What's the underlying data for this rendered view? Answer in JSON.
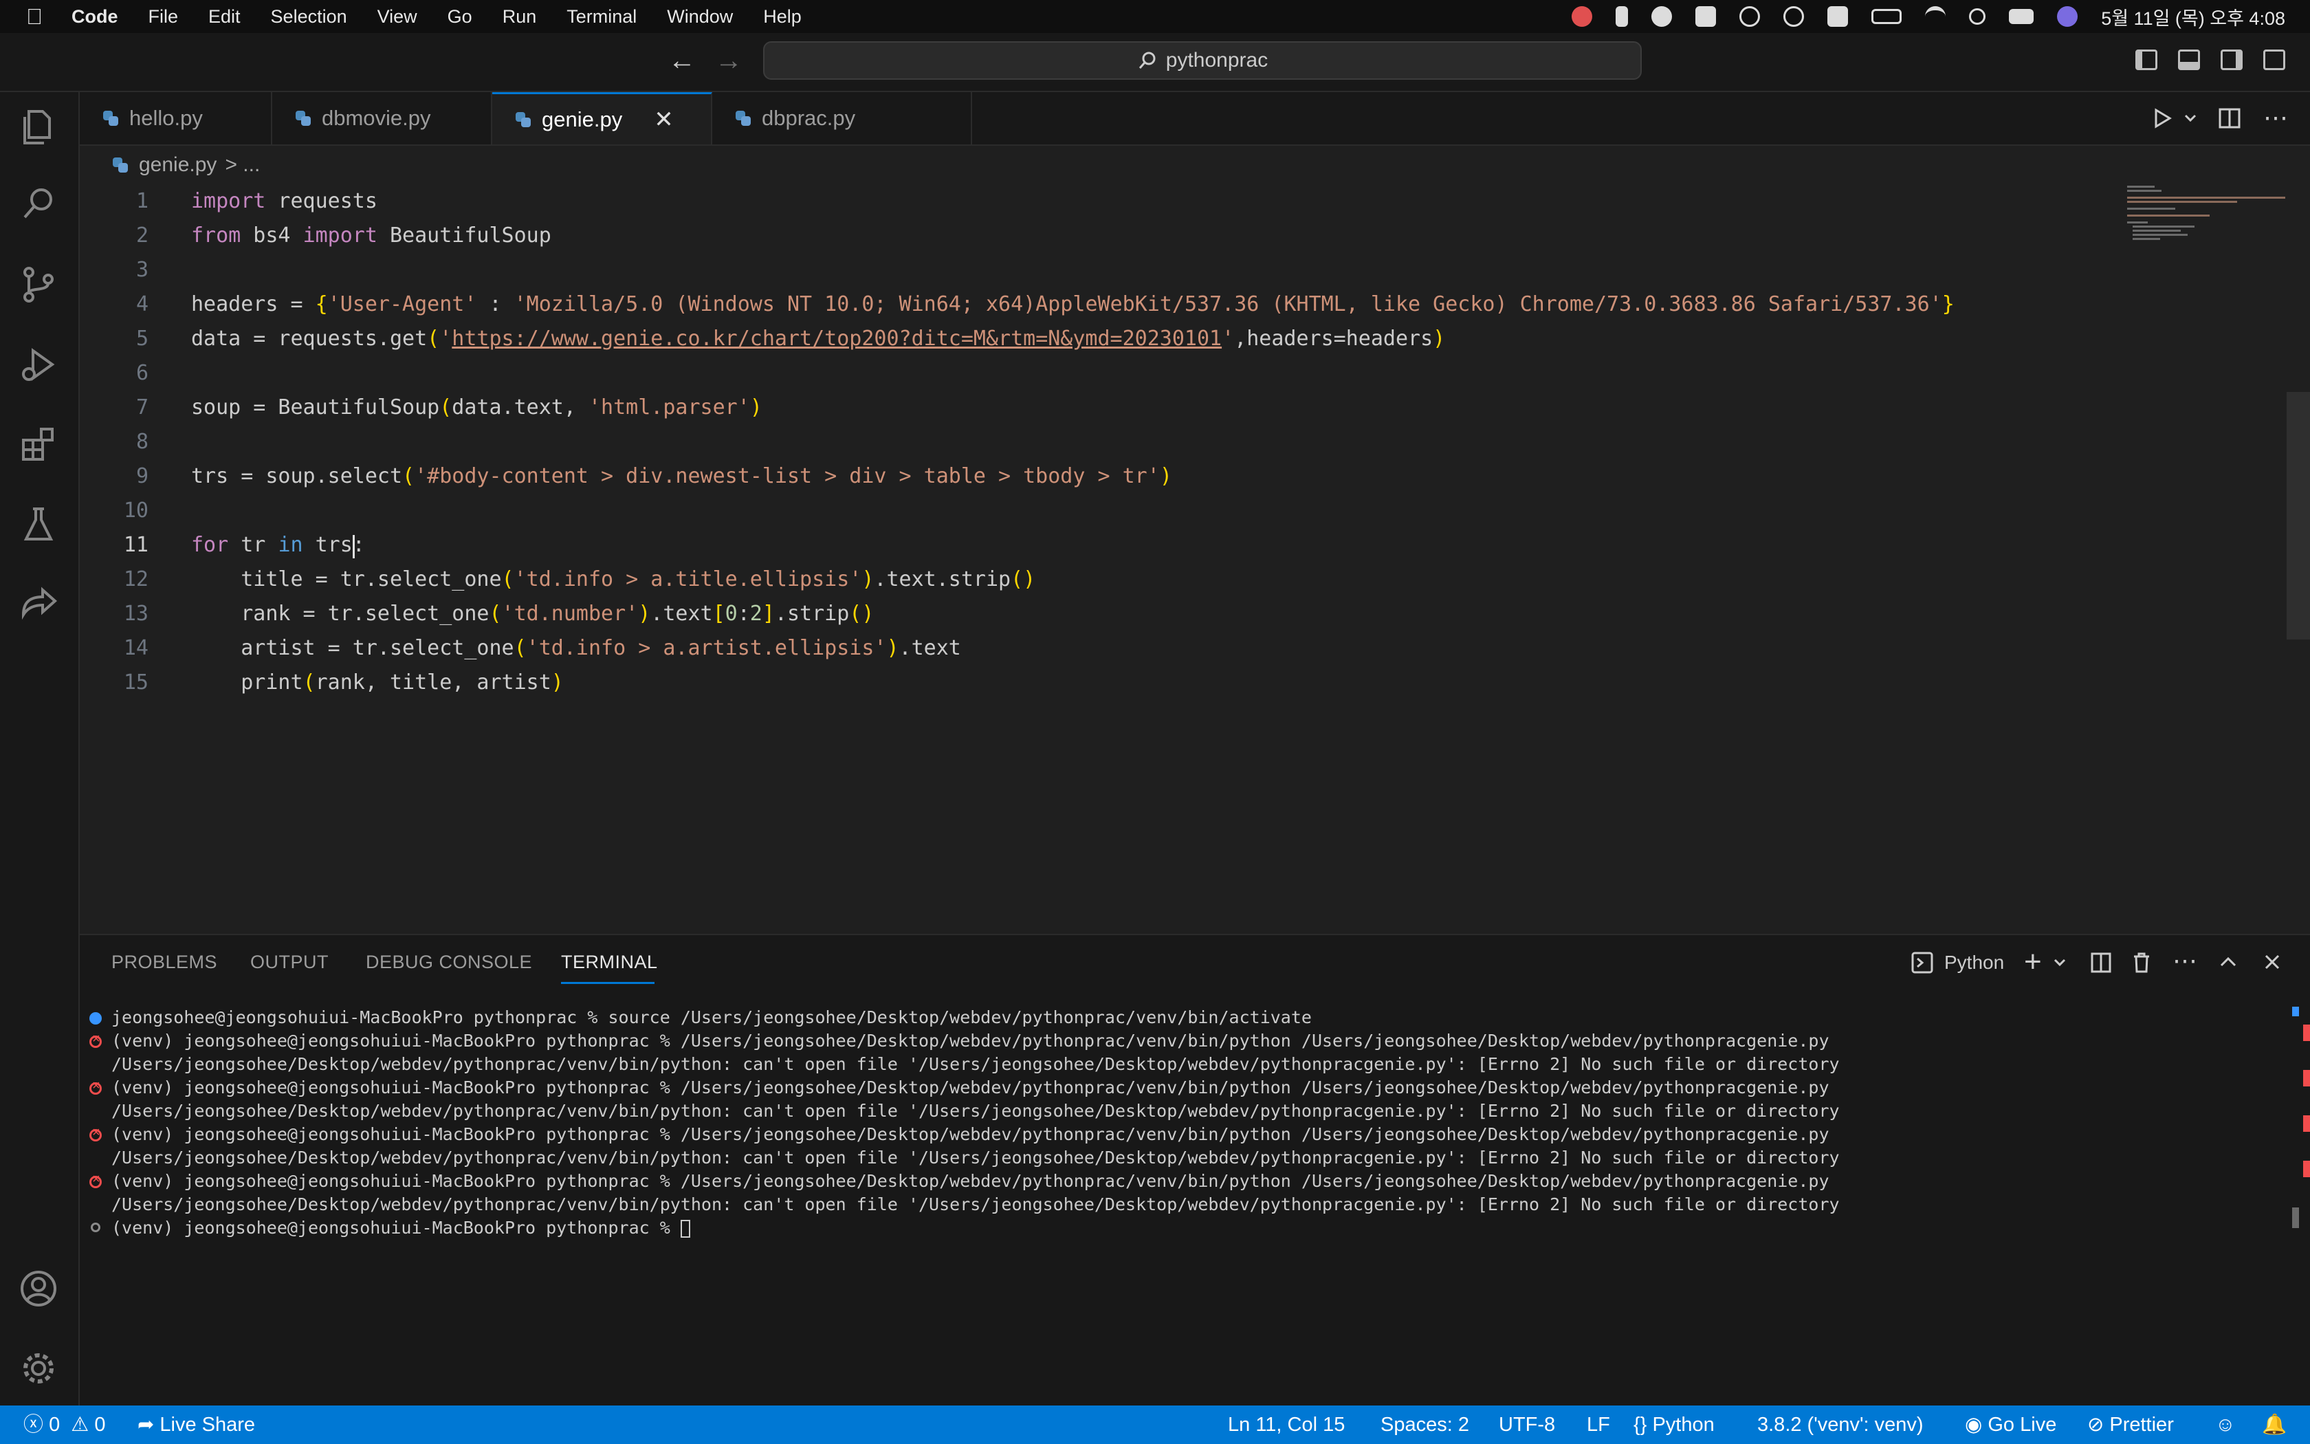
{
  "menubar": {
    "app": "Code",
    "items": [
      "File",
      "Edit",
      "Selection",
      "View",
      "Go",
      "Run",
      "Terminal",
      "Window",
      "Help"
    ],
    "clock": "5월 11일 (목) 오후 4:08"
  },
  "titlebar": {
    "search": "pythonprac"
  },
  "tabs": [
    {
      "label": "hello.py"
    },
    {
      "label": "dbmovie.py"
    },
    {
      "label": "genie.py",
      "close": "✕"
    },
    {
      "label": "dbprac.py"
    }
  ],
  "breadcrumb": {
    "file": "genie.py",
    "rest": "> ..."
  },
  "editor": {
    "line_numbers": [
      "1",
      "2",
      "3",
      "4",
      "5",
      "6",
      "7",
      "8",
      "9",
      "10",
      "11",
      "12",
      "13",
      "14",
      "15"
    ],
    "current_line": "11"
  },
  "panel": {
    "tabs": [
      "PROBLEMS",
      "OUTPUT",
      "DEBUG CONSOLE",
      "TERMINAL"
    ],
    "active_tab": "TERMINAL",
    "terminal_name": "Python",
    "terminal_lines": [
      "jeongsohee@jeongsohuiui-MacBookPro pythonprac % source /Users/jeongsohee/Desktop/webdev/pythonprac/venv/bin/activate",
      "(venv) jeongsohee@jeongsohuiui-MacBookPro pythonprac % /Users/jeongsohee/Desktop/webdev/pythonprac/venv/bin/python /Users/jeongsohee/Desktop/webdev/pythonpracgenie.py",
      "/Users/jeongsohee/Desktop/webdev/pythonprac/venv/bin/python: can't open file '/Users/jeongsohee/Desktop/webdev/pythonpracgenie.py': [Errno 2] No such file or directory",
      "(venv) jeongsohee@jeongsohuiui-MacBookPro pythonprac % /Users/jeongsohee/Desktop/webdev/pythonprac/venv/bin/python /Users/jeongsohee/Desktop/webdev/pythonpracgenie.py",
      "/Users/jeongsohee/Desktop/webdev/pythonprac/venv/bin/python: can't open file '/Users/jeongsohee/Desktop/webdev/pythonpracgenie.py': [Errno 2] No such file or directory",
      "(venv) jeongsohee@jeongsohuiui-MacBookPro pythonprac % /Users/jeongsohee/Desktop/webdev/pythonprac/venv/bin/python /Users/jeongsohee/Desktop/webdev/pythonpracgenie.py",
      "/Users/jeongsohee/Desktop/webdev/pythonprac/venv/bin/python: can't open file '/Users/jeongsohee/Desktop/webdev/pythonpracgenie.py': [Errno 2] No such file or directory",
      "(venv) jeongsohee@jeongsohuiui-MacBookPro pythonprac % /Users/jeongsohee/Desktop/webdev/pythonprac/venv/bin/python /Users/jeongsohee/Desktop/webdev/pythonpracgenie.py",
      "/Users/jeongsohee/Desktop/webdev/pythonprac/venv/bin/python: can't open file '/Users/jeongsohee/Desktop/webdev/pythonpracgenie.py': [Errno 2] No such file or directory",
      "(venv) jeongsohee@jeongsohuiui-MacBookPro pythonprac % "
    ]
  },
  "statusbar": {
    "errors": "0",
    "warnings": "0",
    "live_share": "Live Share",
    "position": "Ln 11, Col 15",
    "spaces": "Spaces: 2",
    "encoding": "UTF-8",
    "eol": "LF",
    "language": "Python",
    "interpreter": "3.8.2 ('venv': venv)",
    "go_live": "Go Live",
    "prettier": "Prettier"
  },
  "colors": {
    "accent": "#0078d4",
    "keyword": "#569cd6",
    "control": "#c586c0",
    "string": "#ce9178",
    "error": "#f14c4c"
  }
}
